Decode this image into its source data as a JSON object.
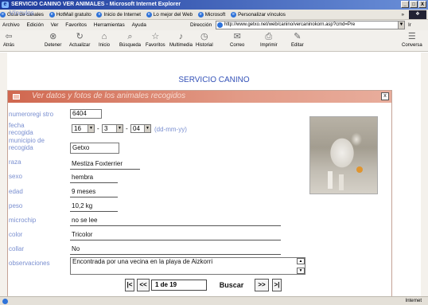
{
  "window": {
    "title": "SERVICIO CANINO VER ANIMALES - Microsoft Internet Explorer",
    "controls": [
      "_",
      "□",
      "X"
    ]
  },
  "links_bar": {
    "label": "Vínculos",
    "items": [
      "Guía de canales",
      "HotMail gratuito",
      "Inicio de Internet",
      "Lo mejor del Web",
      "Microsoft",
      "Personalizar vínculos"
    ],
    "more": "»"
  },
  "menu": {
    "items": [
      "Archivo",
      "Edición",
      "Ver",
      "Favoritos",
      "Herramientas",
      "Ayuda"
    ],
    "address_label": "Dirección",
    "address_value": "http://www.getxo.net/web/canino/vercaninokorn.asp?cmd=Pre",
    "go": "Ir"
  },
  "toolbar": {
    "buttons": [
      {
        "label": "Atrás",
        "icon": "back-arrow-icon"
      },
      {
        "label": "Detener",
        "icon": "stop-icon"
      },
      {
        "label": "Actualizar",
        "icon": "refresh-icon"
      },
      {
        "label": "Inicio",
        "icon": "home-icon"
      },
      {
        "label": "Búsqueda",
        "icon": "search-icon"
      },
      {
        "label": "Favoritos",
        "icon": "favorites-icon"
      },
      {
        "label": "Multimedia",
        "icon": "multimedia-icon"
      },
      {
        "label": "Historial",
        "icon": "history-icon"
      },
      {
        "label": "Correo",
        "icon": "mail-icon"
      },
      {
        "label": "Imprimir",
        "icon": "print-icon"
      },
      {
        "label": "Editar",
        "icon": "edit-icon"
      },
      {
        "label": "Conversa",
        "icon": "discuss-icon"
      }
    ]
  },
  "page": {
    "title": "SERVICIO CANINO",
    "panel_title": "Ver datos y fotos de los animales recogidos",
    "close": "x"
  },
  "form": {
    "numero_label": "numeroregi stro",
    "numero_value": "6404",
    "fecha_label": "fecha recogida",
    "fecha_day": "16",
    "fecha_month": "3",
    "fecha_year": "04",
    "fecha_format": "(dd-mm-yy)",
    "municipio_label": "municipio de recogida",
    "municipio_value": "Getxo",
    "raza_label": "raza",
    "raza_value": "Mestiza Foxterrier",
    "sexo_label": "sexo",
    "sexo_value": "hembra",
    "edad_label": "edad",
    "edad_value": "9 meses",
    "peso_label": "peso",
    "peso_value": "10,2 kg",
    "microchip_label": "microchip",
    "microchip_value": "no se lee",
    "color_label": "color",
    "color_value": "Tricolor",
    "collar_label": "collar",
    "collar_value": "No",
    "observaciones_label": "observaciones",
    "observaciones_value": "Encontrada por una vecina en la playa de Aizkorri"
  },
  "navigation": {
    "first": "|<",
    "prev": "<<",
    "counter": "1 de 19",
    "search": "Buscar",
    "next": ">>",
    "last": ">|"
  },
  "status": {
    "zone": "Internet"
  },
  "colors": {
    "panel_header": "#d0674f",
    "label": "#7a8fd0",
    "title": "#3553b8"
  }
}
